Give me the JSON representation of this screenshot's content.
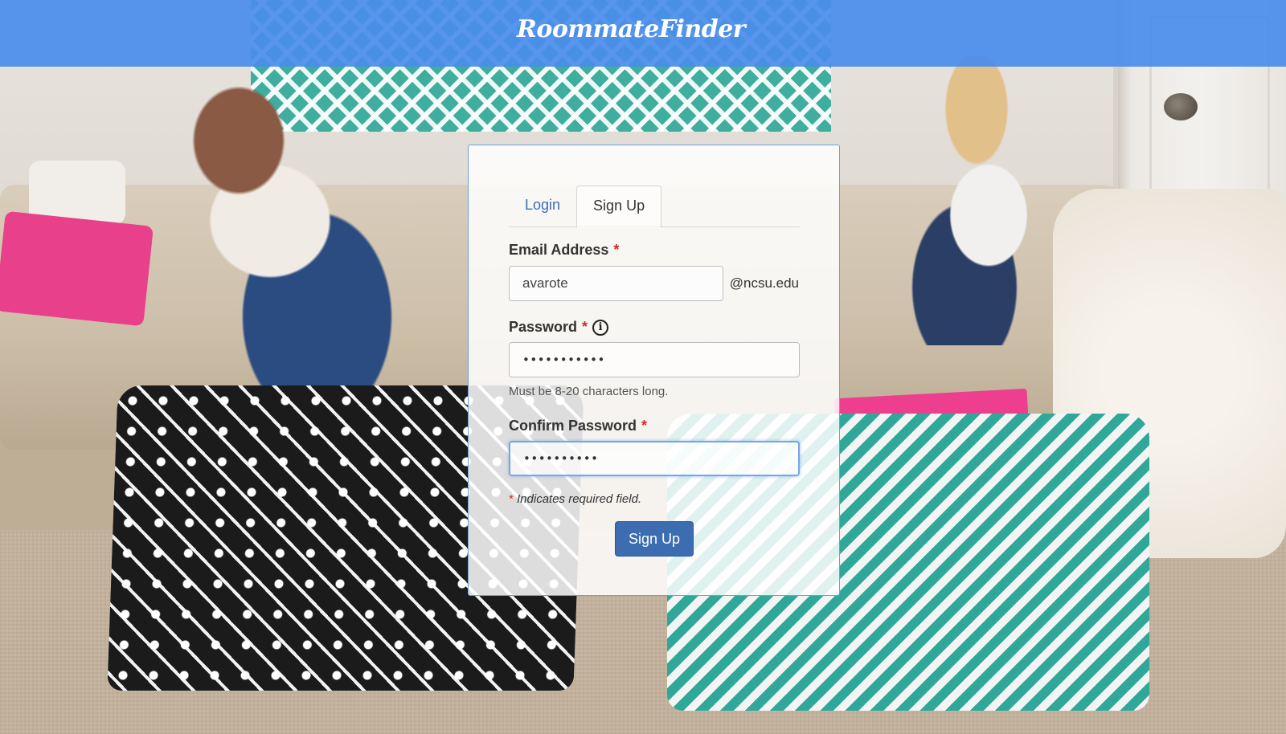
{
  "header": {
    "title": "RoommateFinder"
  },
  "tabs": [
    {
      "label": "Login",
      "active": false
    },
    {
      "label": "Sign Up",
      "active": true
    }
  ],
  "form": {
    "email": {
      "label": "Email Address",
      "required_mark": "*",
      "value": "avarote",
      "suffix": "@ncsu.edu"
    },
    "password": {
      "label": "Password",
      "required_mark": "*",
      "info_icon": "info-icon",
      "masked_value": "•••••••••••",
      "help": "Must be 8-20 characters long."
    },
    "confirm_password": {
      "label": "Confirm Password",
      "required_mark": "*",
      "masked_value": "••••••••••",
      "focused": true
    },
    "required_note": {
      "mark": "*",
      "text": "Indicates required field."
    },
    "submit_label": "Sign Up"
  },
  "colors": {
    "header_bg": "#4a8ceb",
    "primary_button": "#3b6db0",
    "required": "#c9302c",
    "link": "#3a6fb3"
  }
}
